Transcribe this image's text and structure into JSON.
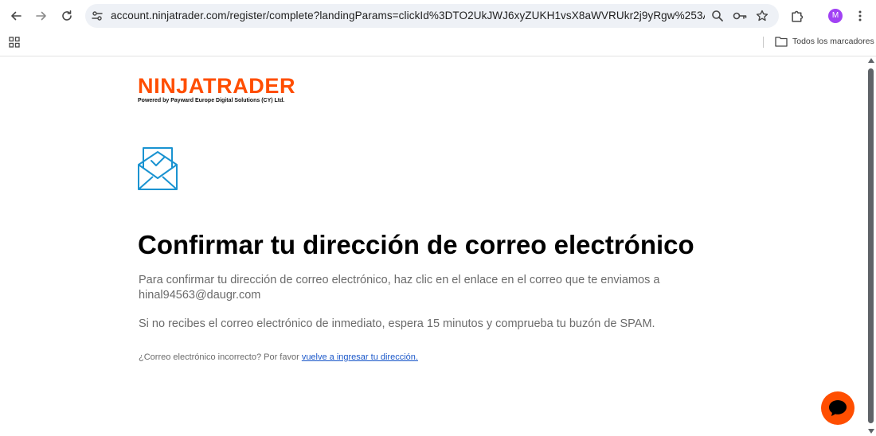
{
  "browser": {
    "url": "account.ninjatrader.com/register/complete?landingParams=clickId%3DTO2UkJWJ6xyZUKH1vsX8aWVRUkr2j9yRgw%253AJx00%26_gl%...",
    "avatar_letter": "M",
    "bookmarks_label": "Todos los marcadores"
  },
  "page": {
    "brand": "NINJATRADER",
    "brand_sub": "Powered by Payward Europe Digital Solutions (CY) Ltd.",
    "brand_color": "#ff4e00",
    "heading": "Confirmar tu dirección de correo electrónico",
    "instruction": "Para confirmar tu dirección de correo electrónico, haz clic en el enlace en el correo que te enviamos a",
    "email": "hinal94563@daugr.com",
    "spam_note": "Si no recibes el correo electrónico de inmediato, espera 15 minutos y comprueba tu buzón de SPAM.",
    "wrong_email_prompt": "¿Correo electrónico incorrecto? Por favor",
    "reenter_link": "vuelve a ingresar tu dirección."
  },
  "icons": {
    "back": "arrow-left-icon",
    "forward": "arrow-right-icon",
    "reload": "reload-icon",
    "site_info": "tune-icon",
    "zoom": "magnifier-icon",
    "password": "key-icon",
    "bookmark": "star-icon",
    "extensions": "puzzle-icon",
    "menu": "kebab-icon",
    "apps": "grid-icon",
    "folder": "folder-icon",
    "mail": "envelope-check-icon",
    "chat": "chat-bubble-icon"
  }
}
